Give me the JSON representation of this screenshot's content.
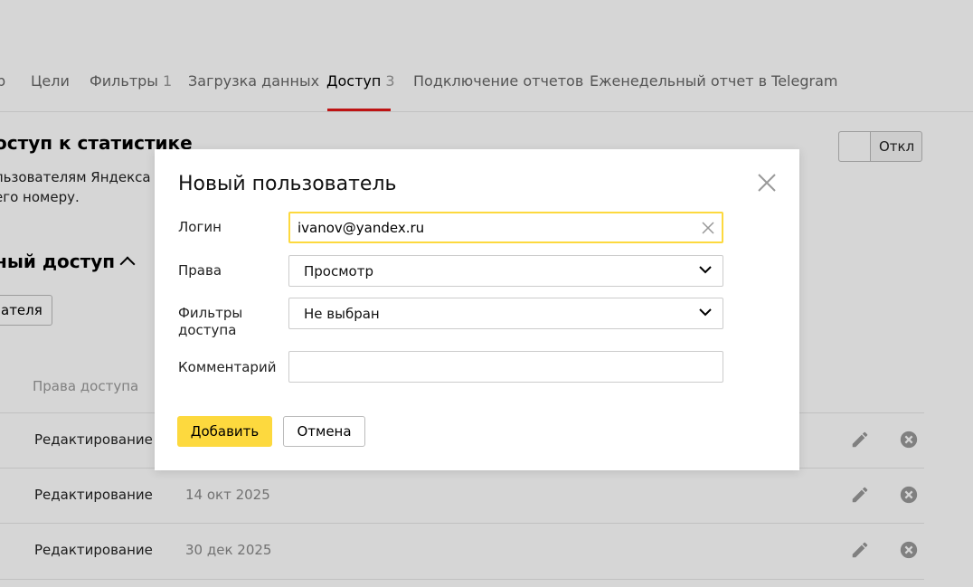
{
  "tabs": [
    {
      "label": "р",
      "count": ""
    },
    {
      "label": "Цели",
      "count": ""
    },
    {
      "label": "Фильтры",
      "count": "1"
    },
    {
      "label": "Загрузка данных",
      "count": ""
    },
    {
      "label": "Доступ",
      "count": "3"
    },
    {
      "label": "Подключение отчетов",
      "count": ""
    },
    {
      "label": "Еженедельный отчет в Telegram",
      "count": ""
    }
  ],
  "stats": {
    "title": "оступ к статистике",
    "desc_line1": "льзователям Яндекса пр",
    "desc_line2": "его номеру.",
    "toggle_label": "Откл"
  },
  "access": {
    "title": "ный доступ",
    "add_user_button": "ателя",
    "col_rights": "Права доступа",
    "rows": [
      {
        "rights": "Редактирование",
        "date": ""
      },
      {
        "rights": "Редактирование",
        "date": "14 окт 2025"
      },
      {
        "rights": "Редактирование",
        "date": "30 дек 2025"
      }
    ]
  },
  "modal": {
    "title": "Новый пользователь",
    "login_label": "Логин",
    "login_value": "ivanov@yandex.ru",
    "rights_label": "Права",
    "rights_value": "Просмотр",
    "filters_label_1": "Фильтры",
    "filters_label_2": "доступа",
    "filters_value": "Не выбран",
    "comment_label": "Комментарий",
    "comment_value": "",
    "add_button": "Добавить",
    "cancel_button": "Отмена"
  },
  "colors": {
    "accent_yellow": "#fdd93e",
    "tab_active_underline": "#e31717"
  },
  "icons": {
    "close": "close-icon",
    "clear": "clear-icon",
    "chevron": "chevron-down-icon",
    "edit": "pencil-icon",
    "delete": "delete-circle-icon"
  }
}
